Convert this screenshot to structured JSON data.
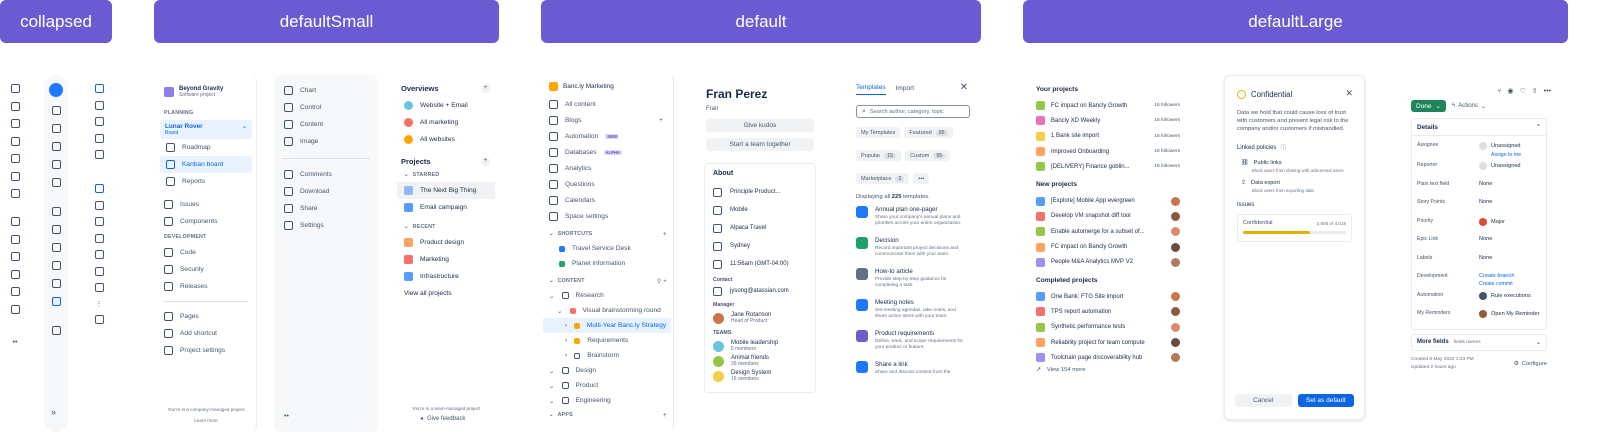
{
  "headers": {
    "collapsed": "collapsed",
    "defaultSmall": "defaultSmall",
    "default": "default",
    "defaultLarge": "defaultLarge"
  },
  "p2": {
    "project": {
      "name": "Beyond Gravity",
      "type": "Software project"
    },
    "planning": "PLANNING",
    "board": {
      "name": "Lunar Rover",
      "type": "Board"
    },
    "planning_items": [
      "Roadmap",
      "Kanban board",
      "Reports"
    ],
    "mid_items": [
      "Issues",
      "Components"
    ],
    "development": "DEVELOPMENT",
    "dev_items": [
      "Code",
      "Security",
      "Releases"
    ],
    "bottom_items": [
      "Pages",
      "Add shortcut",
      "Project settings"
    ],
    "footer": "You're in a company-managed project",
    "learn": "Learn more"
  },
  "p3": {
    "items1": [
      "Chart",
      "Control",
      "Content",
      "Image"
    ],
    "items2": [
      "Comments",
      "Download",
      "Share",
      "Settings"
    ],
    "more": "••"
  },
  "p4": {
    "overviews": "Overviews",
    "overview_items": [
      "Website + Email",
      "All marketing",
      "All websites"
    ],
    "projects": "Projects",
    "starred": "STARRED",
    "starred_items": [
      "The Next Big Thing",
      "Email campaign"
    ],
    "recent": "RECENT",
    "recent_items": [
      "Product design",
      "Marketing",
      "Infrastructure"
    ],
    "view_all": "View all projects",
    "footer": "You're in a team-managed project",
    "feedback": "Give feedback"
  },
  "p5": {
    "space": "Banc.ly Marketing",
    "items": [
      "All content",
      "Blogs",
      "Automation",
      "Databases",
      "Analytics",
      "Questions",
      "Calendars",
      "Space settings"
    ],
    "badges": {
      "automation": "NEW",
      "databases": "ALPHA"
    },
    "shortcuts": "SHORTCUTS",
    "shortcut_items": [
      "Travel Service Desk",
      "Planet information"
    ],
    "content": "CONTENT",
    "tree": [
      "Research",
      "Visual brainstorming round",
      "Multi-Year Banc.ly Strategy",
      "Requirements",
      "Brainstorm",
      "Design",
      "Product",
      "Engineering"
    ],
    "apps": "APPS"
  },
  "p6": {
    "name": "Fran Perez",
    "nick": "Fran",
    "kudos": "Give kudos",
    "team": "Start a team together",
    "about": "About",
    "about_items": [
      "Principle Product...",
      "Mobile",
      "Alpaca Travel",
      "Sydney",
      "11:56am (GMT-04:00)"
    ],
    "contact": "Contact",
    "email": "jysong@atassian.com",
    "manager": "Manager",
    "manager_name": "Jane Rotanson",
    "manager_role": "Head of Product",
    "teams": "TEAMS",
    "team_items": [
      {
        "name": "Mobile leadership",
        "members": "5 members"
      },
      {
        "name": "Animal friends",
        "members": "26 members"
      },
      {
        "name": "Design System",
        "members": "16 members"
      }
    ]
  },
  "p7": {
    "tabs": [
      "Templates",
      "Import"
    ],
    "search_placeholder": "Search author, category, topic",
    "chips": [
      {
        "label": "My Templates",
        "count": ""
      },
      {
        "label": "Featured",
        "count": "95"
      },
      {
        "label": "Popular",
        "count": "15"
      },
      {
        "label": "Custom",
        "count": "95"
      },
      {
        "label": "Marketplace",
        "count": "2"
      }
    ],
    "more": "•••",
    "displaying_pre": "Displaying all",
    "displaying_count": "225",
    "displaying_post": "templates.",
    "templates": [
      {
        "title": "Annual plan one-pager",
        "desc": "Share your company's annual plans and priorities across your entire organization.",
        "color": "#1d7afc"
      },
      {
        "title": "Decision",
        "desc": "Record important project decisions and communicate them with your team.",
        "color": "#22a06b"
      },
      {
        "title": "How-to article",
        "desc": "Provide step-by-step guidance for completing a task.",
        "color": "#626f86"
      },
      {
        "title": "Meeting notes",
        "desc": "Set meeting agendas, take notes, and share action items with your team.",
        "color": "#1d7afc"
      },
      {
        "title": "Product requirements",
        "desc": "Define, track, and scope requirements for your product or feature.",
        "color": "#6e5dc6"
      },
      {
        "title": "Share a link",
        "desc": "Share and discuss content from the",
        "color": "#1d7afc"
      }
    ]
  },
  "p8": {
    "your_projects": "Your projects",
    "your_items": [
      {
        "name": "FC impact on Bancly Growth",
        "followers": "18 followers",
        "color": "#94c748"
      },
      {
        "name": "Bancly XD Weekly",
        "followers": "18 followers",
        "color": "#e774bb"
      },
      {
        "name": "1 Bank site import",
        "followers": "18 followers",
        "color": "#f5cd47"
      },
      {
        "name": "Improved Onboarding",
        "followers": "18 followers",
        "color": "#fea362"
      },
      {
        "name": "[DELIVERY] Finance goblin...",
        "followers": "18 followers",
        "color": "#94c748"
      }
    ],
    "new_projects": "New projects",
    "new_items": [
      "[Explore] Mobile App evergreen",
      "Develop VM snapshot diff tool",
      "Enable automerge for a subset of...",
      "FC impact on Bancly Growth",
      "People M&A Analytics MVP V2"
    ],
    "completed": "Completed projects",
    "completed_items": [
      "One Bank: FTG Site import",
      "TPS report automation",
      "Synthetic performance tests",
      "Reliability project for team compute",
      "Toolchain page discoverability hub"
    ],
    "view_more": "View 154 more"
  },
  "p9": {
    "title": "Confidential",
    "desc": "Data we hold that could cause loss of trust with customers and present legal risk to the company and/or customers if mishandled.",
    "linked": "Linked policies",
    "policies": [
      {
        "name": "Public links",
        "desc": "Block users from sharing with unlicensed users"
      },
      {
        "name": "Data export",
        "desc": "Block users from exporting data"
      }
    ],
    "issues": "Issues",
    "issue_label": "Confidential",
    "issue_count": "2,605 of 4,018",
    "progress": 0.65,
    "cancel": "Cancel",
    "default": "Set as default"
  },
  "p10": {
    "done": "Done",
    "actions": "Actions",
    "details": "Details",
    "fields": [
      {
        "label": "Assignee",
        "value": "Unassigned",
        "extra": "Assign to me"
      },
      {
        "label": "Reporter",
        "value": "Unassigned"
      },
      {
        "label": "Plain text field",
        "value": "None"
      },
      {
        "label": "Story Points",
        "value": "None"
      },
      {
        "label": "Priority",
        "value": "Major"
      },
      {
        "label": "Epic Link",
        "value": "None"
      },
      {
        "label": "Labels",
        "value": "None"
      },
      {
        "label": "Development",
        "value": "Create branch",
        "extra": "Create commit"
      },
      {
        "label": "Automation",
        "value": "Rule executions"
      },
      {
        "label": "My Reminders",
        "value": "Open My Reminder"
      }
    ],
    "more_fields": "More fields",
    "more_fields_hint": "fields names",
    "created": "Created 8 May 2022 1:43 PM",
    "updated": "Updated 2 hours ago",
    "configure": "Configure"
  },
  "colors": {
    "header": "#6b5bd2",
    "accent": "#0c66e4",
    "text": "#172b4d",
    "subtle": "#626f86"
  }
}
